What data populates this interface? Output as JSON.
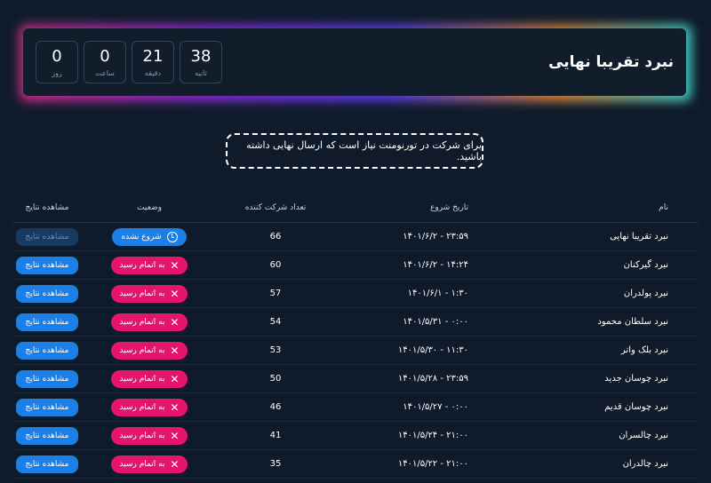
{
  "hero": {
    "title": "نبرد تقریبا نهایی",
    "countdown": [
      {
        "value": "38",
        "label": "ثانیه"
      },
      {
        "value": "21",
        "label": "دقیقه"
      },
      {
        "value": "0",
        "label": "ساعت"
      },
      {
        "value": "0",
        "label": "روز"
      }
    ]
  },
  "notice": "برای شرکت در تورنومنت نیاز است که ارسال نهایی داشته باشید.",
  "table": {
    "headers": {
      "name": "نام",
      "start_date": "تاریخ شروع",
      "participants": "تعداد شرکت کننده",
      "status": "وضعیت",
      "results": "مشاهده نتایج"
    },
    "status_labels": {
      "ended": "به اتمام رسید",
      "not_started": "شروع نشده"
    },
    "view_label": "مشاهده نتایج",
    "rows": [
      {
        "name": "نبرد تقریبا نهایی",
        "date": "۱۴۰۱/۶/۲ - ۲۳:۵۹",
        "count": "66",
        "status": "not_started"
      },
      {
        "name": "نبرد گیرکنان",
        "date": "۱۴۰۱/۶/۲ - ۱۴:۲۴",
        "count": "60",
        "status": "ended"
      },
      {
        "name": "نبرد پولدران",
        "date": "۱۴۰۱/۶/۱ - ۱:۳۰",
        "count": "57",
        "status": "ended"
      },
      {
        "name": "نبرد سلطان محمود",
        "date": "۱۴۰۱/۵/۳۱ - ۰:۰۰",
        "count": "54",
        "status": "ended"
      },
      {
        "name": "نبرد بلک واتر",
        "date": "۱۴۰۱/۵/۳۰ - ۱۱:۳۰",
        "count": "53",
        "status": "ended"
      },
      {
        "name": "نبرد چوسان جدید",
        "date": "۱۴۰۱/۵/۲۸ - ۲۳:۵۹",
        "count": "50",
        "status": "ended"
      },
      {
        "name": "نبرد چوسان قدیم",
        "date": "۱۴۰۱/۵/۲۷ - ۰:۰۰",
        "count": "46",
        "status": "ended"
      },
      {
        "name": "نبرد چالسران",
        "date": "۱۴۰۱/۵/۲۴ - ۲۱:۰۰",
        "count": "41",
        "status": "ended"
      },
      {
        "name": "نبرد چالدران",
        "date": "۱۴۰۱/۵/۲۲ - ۲۱:۰۰",
        "count": "35",
        "status": "ended"
      }
    ]
  }
}
